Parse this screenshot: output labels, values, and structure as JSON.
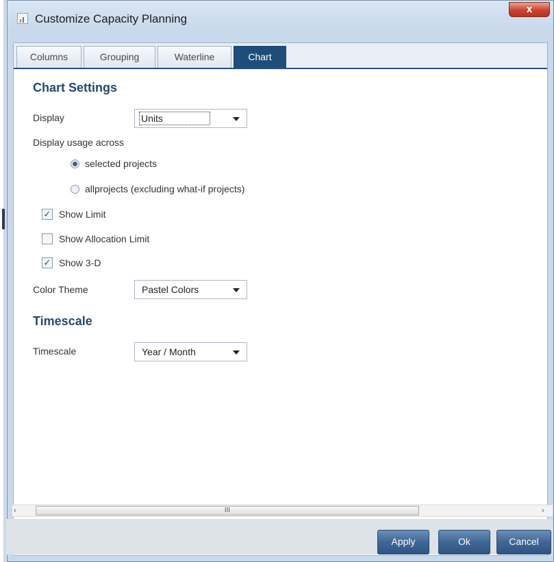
{
  "window": {
    "title": "Customize Capacity Planning",
    "close_label": "x"
  },
  "tabs": [
    {
      "label": "Columns",
      "active": false
    },
    {
      "label": "Grouping",
      "active": false
    },
    {
      "label": "Waterline",
      "active": false
    },
    {
      "label": "Chart",
      "active": true
    }
  ],
  "chart_settings": {
    "heading": "Chart Settings",
    "display": {
      "label": "Display",
      "value": "Units"
    },
    "usage": {
      "label": "Display usage across",
      "options": [
        {
          "label": "selected projects",
          "checked": true
        },
        {
          "label": "allprojects (excluding what-if projects)",
          "checked": false
        }
      ]
    },
    "show_limit": {
      "label": "Show Limit",
      "checked": true
    },
    "show_allocation_limit": {
      "label": "Show Allocation Limit",
      "checked": false
    },
    "show_3d": {
      "label": "Show 3-D",
      "checked": true
    },
    "color_theme": {
      "label": "Color Theme",
      "value": "Pastel Colors"
    }
  },
  "timescale": {
    "heading": "Timescale",
    "label": "Timescale",
    "value": "Year / Month"
  },
  "scrollbar": {
    "left_arrow": "‹",
    "right_arrow": "›",
    "grip": "III"
  },
  "buttons": {
    "apply": "Apply",
    "ok": "Ok",
    "cancel": "Cancel"
  },
  "colors": {
    "accent": "#1f4d7a",
    "heading": "#24486e",
    "button": "#3f6795"
  }
}
